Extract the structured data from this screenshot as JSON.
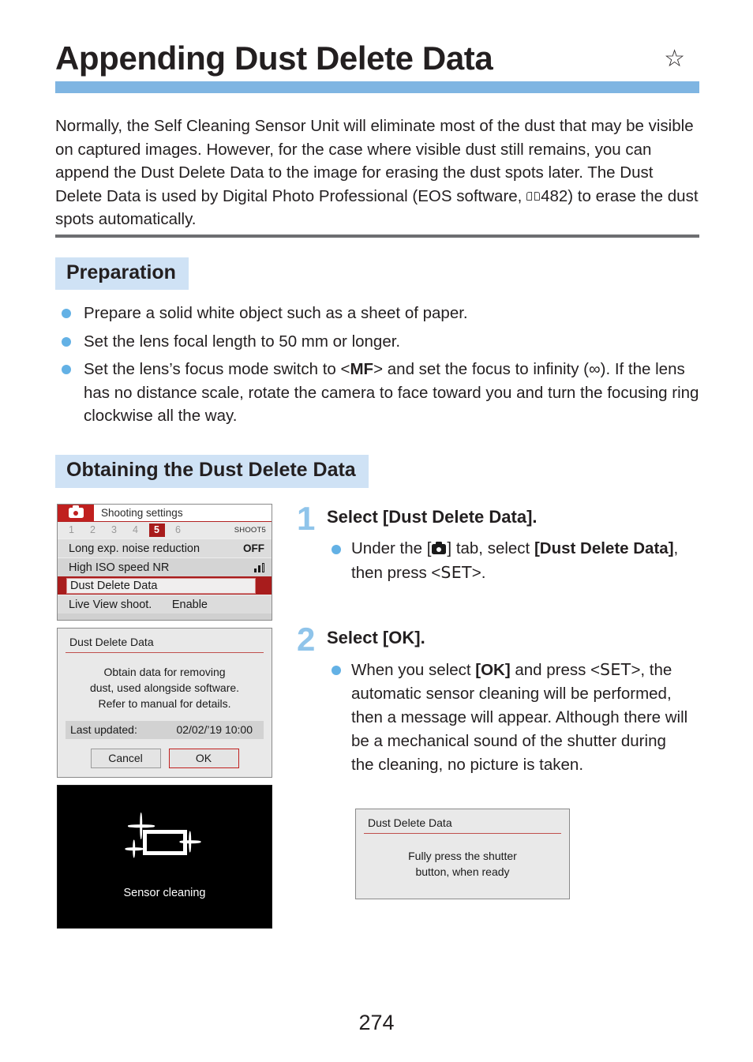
{
  "header": {
    "title": "Appending Dust Delete Data",
    "star_icon": "☆",
    "accent_bar_color": "#7fb5e2"
  },
  "intro": {
    "part1": "Normally, the Self Cleaning Sensor Unit will eliminate most of the dust that may be visible on captured images. However, for the case where visible dust still remains, you can append the Dust Delete Data to the image for erasing the dust spots later. The Dust Delete Data is used by Digital Photo Professional (EOS software, ",
    "page_ref": "482",
    "part2": ") to erase the dust spots automatically."
  },
  "preparation": {
    "heading": "Preparation",
    "heading_bg": "#cfe2f5",
    "items": [
      {
        "text": "Prepare a solid white object such as a sheet of paper."
      },
      {
        "text": "Set the lens focal length to 50 mm or longer."
      },
      {
        "pre": "Set the lens’s focus mode switch to <",
        "bold": "MF",
        "post": "> and set the focus to infinity (∞). If the lens has no distance scale, rotate the camera to face toward you and turn the focusing ring clockwise all the way."
      }
    ]
  },
  "obtaining": {
    "heading": "Obtaining the Dust Delete Data",
    "heading_bg": "#cfe2f5"
  },
  "camera_menu": {
    "tab_icon": "camera-icon",
    "title": "Shooting settings",
    "tabs": [
      "1",
      "2",
      "3",
      "4",
      "5",
      "6"
    ],
    "active_tab": "5",
    "group_label": "SHOOT5",
    "rows": [
      {
        "label": "Long exp. noise reduction",
        "value": "OFF",
        "selected": false
      },
      {
        "label": "High ISO speed NR",
        "value": "nr-bars-icon",
        "selected": false
      },
      {
        "label": "Dust Delete Data",
        "value": "",
        "selected": true
      },
      {
        "label": "Live View shoot.",
        "value": "Enable",
        "selected": false
      }
    ],
    "accent_color": "#a81c1c"
  },
  "dialog_obtain": {
    "title": "Dust Delete Data",
    "body_lines": [
      "Obtain data for removing",
      "dust, used alongside software.",
      "Refer to manual for details."
    ],
    "updated_label": "Last updated:",
    "updated_value": "02/02/’19  10:00",
    "cancel_label": "Cancel",
    "ok_label": "OK"
  },
  "sensor_screen": {
    "icon": "sensor-sparkle-icon",
    "label": "Sensor cleaning"
  },
  "steps": [
    {
      "number": "1",
      "title": "Select [Dust Delete Data].",
      "bullet": {
        "pre": "Under the [",
        "icon": "camera-icon",
        "mid": "] tab, select ",
        "bold": "[Dust Delete Data]",
        "post": ", then press <",
        "key": "SET",
        "end": ">."
      }
    },
    {
      "number": "2",
      "title": "Select [OK].",
      "bullet": {
        "pre": "When you select ",
        "bold": "[OK]",
        "mid": " and press <",
        "key": "SET",
        "post": ">, the automatic sensor cleaning will be performed, then a message will appear. Although there will be a mechanical sound of the shutter during the cleaning, no picture is taken."
      }
    }
  ],
  "dialog_ready": {
    "title": "Dust Delete Data",
    "body_lines": [
      "Fully press the shutter",
      "button, when ready"
    ]
  },
  "footer": {
    "page_number": "274"
  }
}
